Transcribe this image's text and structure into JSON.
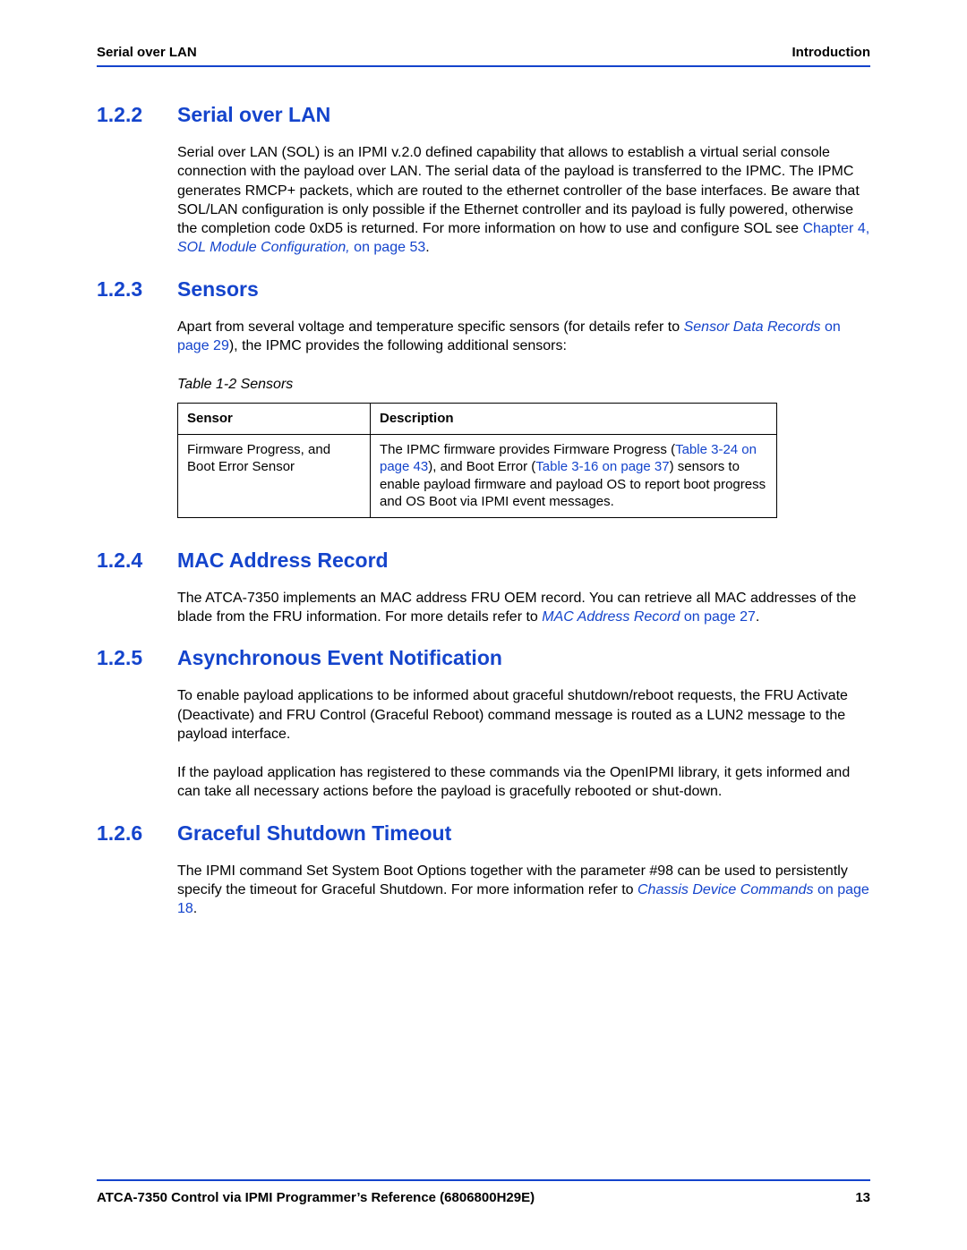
{
  "header": {
    "left": "Serial over LAN",
    "right": "Introduction"
  },
  "sections": {
    "s122": {
      "num": "1.2.2",
      "title": "Serial over LAN",
      "p1a": "Serial over LAN (SOL) is an IPMI v.2.0 defined capability that allows to establish a virtual serial console connection with the payload over LAN. The serial data of the payload is transferred to the IPMC. The IPMC generates RMCP+ packets, which are routed to the ethernet controller of the base interfaces. Be aware that SOL/LAN configuration is only possible if the Ethernet controller and its payload is fully powered, otherwise the completion code 0xD5 is returned. For more information on how to use and configure SOL see ",
      "p1_link1a": "Chapter 4,",
      "p1_link1b": " SOL Module Configuration,",
      "p1_link2": " on page 53",
      "p1b": "."
    },
    "s123": {
      "num": "1.2.3",
      "title": "Sensors",
      "p1a": "Apart from several voltage and temperature specific sensors (for details refer to ",
      "p1_link1": "Sensor Data Records",
      "p1_link2": " on page 29",
      "p1b": "), the IPMC provides the following additional sensors:",
      "table_caption": "Table 1-2 Sensors",
      "th1": "Sensor",
      "th2": "Description",
      "row1_sensor": "Firmware Progress, and Boot Error Sensor",
      "row1_desc_a": "The IPMC firmware provides Firmware Progress (",
      "row1_link1": "Table 3-24 on page 43",
      "row1_desc_b": "), and Boot Error (",
      "row1_link2": "Table 3-16 on page 37",
      "row1_desc_c": ") sensors to enable payload firmware and payload OS to report boot progress and OS Boot via IPMI event messages."
    },
    "s124": {
      "num": "1.2.4",
      "title": "MAC Address Record",
      "p1a": "The ATCA-7350 implements an MAC address FRU OEM record. You can retrieve all MAC addresses of the blade from the FRU information. For more details refer to ",
      "p1_link1": "MAC Address Record",
      "p1_link2": " on page 27",
      "p1b": "."
    },
    "s125": {
      "num": "1.2.5",
      "title": "Asynchronous Event Notification",
      "p1": "To enable payload applications to be informed about graceful shutdown/reboot requests, the FRU Activate (Deactivate) and FRU Control (Graceful Reboot) command message is routed as a LUN2 message to the payload interface.",
      "p2": "If the payload application has registered to these commands via the OpenIPMI library, it gets informed and can take all necessary actions before the payload is gracefully rebooted or shut-down."
    },
    "s126": {
      "num": "1.2.6",
      "title": "Graceful Shutdown Timeout",
      "p1a": "The IPMI command Set System Boot Options together with the parameter #98 can be used to persistently specify the timeout for Graceful Shutdown. For more information refer to ",
      "p1_link1": "Chassis Device Commands",
      "p1_link2": " on page 18",
      "p1b": "."
    }
  },
  "footer": {
    "left": "ATCA-7350 Control via IPMI Programmer’s Reference (6806800H29E)",
    "right": "13"
  }
}
